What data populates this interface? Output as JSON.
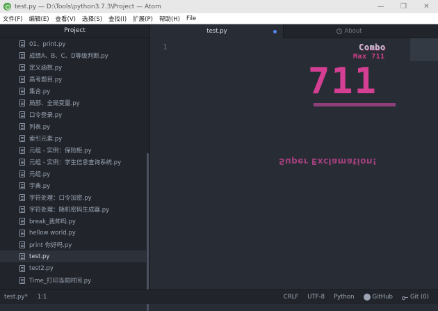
{
  "window": {
    "title": "test.py — D:\\Tools\\python3.7.3\\Project — Atom",
    "controls": [
      "—",
      "❐",
      "✕"
    ]
  },
  "menu": [
    "文件(F)",
    "编辑(E)",
    "查看(V)",
    "选择(S)",
    "查找(I)",
    "扩展(P)",
    "帮助(H)",
    "File"
  ],
  "tree": {
    "header": "Project",
    "files": [
      "01、print.py",
      "成绩A、B、C、D等级判断.py",
      "定义函数.py",
      "高考题目.py",
      "集合.py",
      "局部、全局变量.py",
      "口令登录.py",
      "列表.py",
      "索引元素.py",
      "元组 - 实例：保险柜.py",
      "元组 - 实例：学生信息查询系统.py",
      "元组.py",
      "字典.py",
      "字符处理：口令加密.py",
      "字符处理：随机密码生成器.py",
      "break_我帅吗.py",
      "hellow world.py",
      "print 你好吗.py",
      "test.py",
      "test2.py",
      "Time_打印当前时间.py"
    ],
    "selected_index": 18
  },
  "tabs": {
    "active": "test.py",
    "inactive": "About"
  },
  "editor": {
    "line_number": "1",
    "combo_label": "Combo",
    "combo_max": "Max 711",
    "combo_count": "711",
    "exclamation": "Super Exclamation!"
  },
  "status": {
    "file": "test.py*",
    "cursor": "1:1",
    "line_ending": "CRLF",
    "encoding": "UTF-8",
    "grammar": "Python",
    "github": "GitHub",
    "git": "Git (0)"
  },
  "colors": {
    "accent": "#568af2",
    "combo": "#d43f93"
  }
}
